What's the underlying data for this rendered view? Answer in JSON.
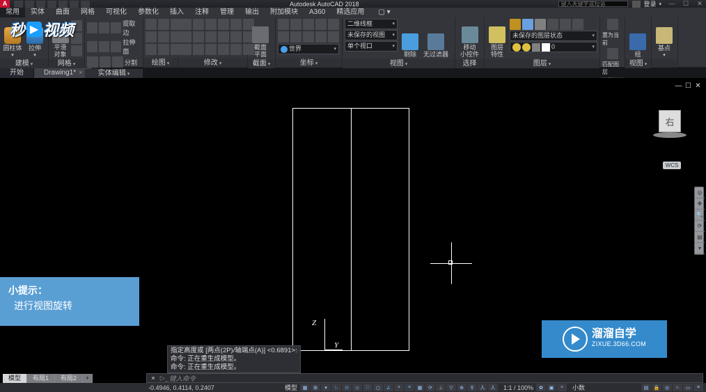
{
  "titlebar": {
    "logo": "A",
    "title": "Autodesk AutoCAD 2018",
    "search_placeholder": "键入关键字或短语",
    "login": "登录",
    "min": "—",
    "max": "☐",
    "close": "✕"
  },
  "menu": {
    "items": [
      "常用",
      "实体",
      "曲面",
      "网格",
      "可视化",
      "参数化",
      "插入",
      "注释",
      "管理",
      "输出",
      "附加模块",
      "A360",
      "精选应用"
    ],
    "active_index": 0
  },
  "ribbon": {
    "panels": [
      {
        "label": "建模",
        "big": [
          {
            "label": "圆柱体"
          },
          {
            "label": "拉伸"
          }
        ]
      },
      {
        "label": "网格",
        "big": [
          {
            "label": "平滑\n对象"
          }
        ]
      },
      {
        "label": "实体编辑",
        "rows": [
          {
            "items": [
              {
                "label": "提取边"
              }
            ]
          },
          {
            "items": [
              {
                "label": "拉伸面"
              }
            ]
          },
          {
            "items": [
              {
                "label": "分割"
              }
            ]
          }
        ]
      },
      {
        "label": "绘图"
      },
      {
        "label": "修改"
      },
      {
        "label": "截面",
        "big": [
          {
            "label": "截面\n平面"
          }
        ]
      },
      {
        "label": "坐标",
        "drops": [
          {
            "value": "世界"
          }
        ]
      },
      {
        "label": "视图",
        "drops": [
          {
            "value": "二维线框"
          },
          {
            "value": "未保存的视图"
          },
          {
            "value": "单个视口"
          }
        ],
        "big": [
          {
            "label": "剔除"
          }
        ]
      },
      {
        "label": "选择",
        "big": [
          {
            "label": "无过滤器"
          },
          {
            "label": "移动\n小控件"
          }
        ]
      },
      {
        "label": "图层",
        "big": [
          {
            "label": "图层\n特性"
          }
        ],
        "rows": [
          {
            "items": [
              {
                "label": "未保存的图层状态"
              }
            ]
          },
          {
            "items": [
              {
                "label": "0"
              }
            ]
          }
        ]
      },
      {
        "label": "组",
        "big": [
          {
            "label": "组"
          }
        ],
        "rows": [
          {
            "items": [
              {
                "label": "置为当前"
              }
            ]
          },
          {
            "items": [
              {
                "label": "匹配图层"
              }
            ]
          }
        ]
      },
      {
        "label": "视图",
        "big": [
          {
            "label": "基点"
          }
        ]
      }
    ]
  },
  "filetabs": {
    "items": [
      {
        "label": "开始",
        "active": false
      },
      {
        "label": "Drawing1*",
        "active": true
      }
    ]
  },
  "canvas": {
    "min_icon": "—",
    "restore_icon": "☐",
    "close_icon": "✕",
    "axis_z": "Z",
    "axis_y": "Y",
    "viewcube": "右",
    "wcs": "WCS"
  },
  "hint": {
    "title": "小提示：",
    "text": "进行视图旋转"
  },
  "brand2": {
    "t1": "溜溜自学",
    "t2": "ZIXUE.3D66.COM"
  },
  "cmdhistory": [
    "指定高度或 [两点(2P)/轴端点(A)] <0.6891>:",
    "命令:  正在重生成模型。",
    "命令:  正在重生成模型。"
  ],
  "cmdinput": {
    "placeholder": "键入命令"
  },
  "layouttabs": {
    "items": [
      "模型",
      "布局1",
      "布局2"
    ]
  },
  "status": {
    "coords": "-0.4946, 0.4114, 0.2407",
    "model_label": "模型",
    "scale": "1:1 / 100%",
    "units": "小数",
    "extra": "#"
  }
}
